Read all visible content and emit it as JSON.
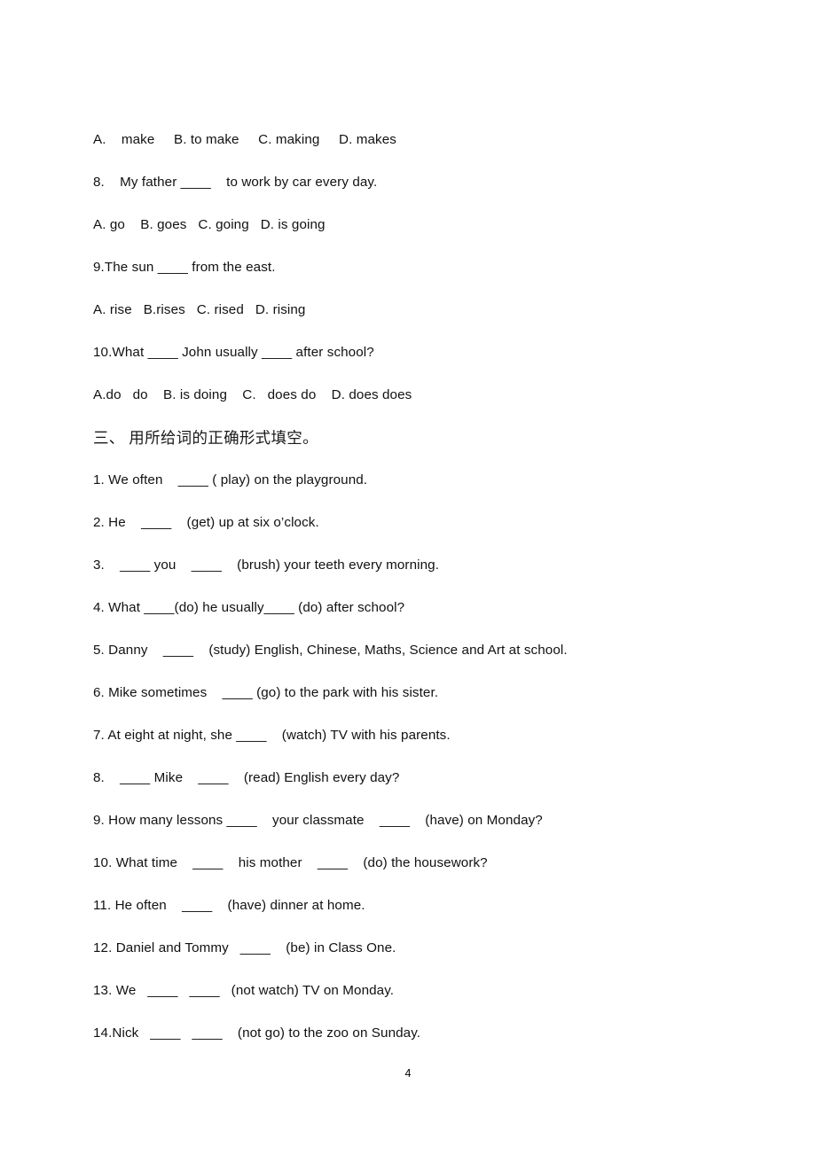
{
  "document": {
    "page_number": "4",
    "background_color": "#ffffff",
    "text_color": "#111111"
  },
  "lines": [
    {
      "id": "mc-q7-options",
      "text": "A.    make     B. to make     C. making     D. makes",
      "style": "latin"
    },
    {
      "id": "mc-q8-stem",
      "text": "8.    My father ____    to work by car every day.",
      "style": "latin"
    },
    {
      "id": "mc-q8-options",
      "text": "A. go    B. goes   C. going   D. is going",
      "style": "latin"
    },
    {
      "id": "mc-q9-stem",
      "text": "9.The sun ____ from the east.",
      "style": "latin"
    },
    {
      "id": "mc-q9-options",
      "text": "A. rise   B.rises   C. rised   D. rising",
      "style": "latin"
    },
    {
      "id": "mc-q10-stem",
      "text": "10.What ____ John usually ____ after school?",
      "style": "latin"
    },
    {
      "id": "mc-q10-options",
      "text": "A.do   do    B. is doing    C.   does do    D. does does",
      "style": "latin"
    },
    {
      "id": "section-three-heading",
      "text": "三、 用所给词的正确形式填空。",
      "style": "heading"
    },
    {
      "id": "fill-q1",
      "text": "1. We often    ____ ( play) on the playground.",
      "style": "latin"
    },
    {
      "id": "fill-q2",
      "text": "2. He    ____    (get) up at six o’clock.",
      "style": "latin"
    },
    {
      "id": "fill-q3",
      "text": "3.    ____ you    ____    (brush) your teeth every morning.",
      "style": "latin"
    },
    {
      "id": "fill-q4",
      "text": "4. What ____(do) he usually____ (do) after school?",
      "style": "latin"
    },
    {
      "id": "fill-q5",
      "text": "5. Danny    ____    (study) English, Chinese, Maths, Science and Art at school.",
      "style": "latin"
    },
    {
      "id": "fill-q6",
      "text": "6. Mike sometimes    ____ (go) to the park with his sister.",
      "style": "latin"
    },
    {
      "id": "fill-q7",
      "text": "7. At eight at night, she ____    (watch) TV with his parents.",
      "style": "latin"
    },
    {
      "id": "fill-q8",
      "text": "8.    ____ Mike    ____    (read) English every day?",
      "style": "latin"
    },
    {
      "id": "fill-q9",
      "text": "9. How many lessons ____    your classmate    ____    (have) on Monday?",
      "style": "latin"
    },
    {
      "id": "fill-q10",
      "text": "10. What time    ____    his mother    ____    (do) the housework?",
      "style": "latin"
    },
    {
      "id": "fill-q11",
      "text": "11. He often    ____    (have) dinner at home.",
      "style": "latin"
    },
    {
      "id": "fill-q12",
      "text": "12. Daniel and Tommy   ____    (be) in Class One.",
      "style": "latin"
    },
    {
      "id": "fill-q13",
      "text": "13. We   ____   ____   (not watch) TV on Monday.",
      "style": "latin"
    },
    {
      "id": "fill-q14",
      "text": "14.Nick   ____   ____    (not go) to the zoo on Sunday.",
      "style": "latin"
    }
  ]
}
